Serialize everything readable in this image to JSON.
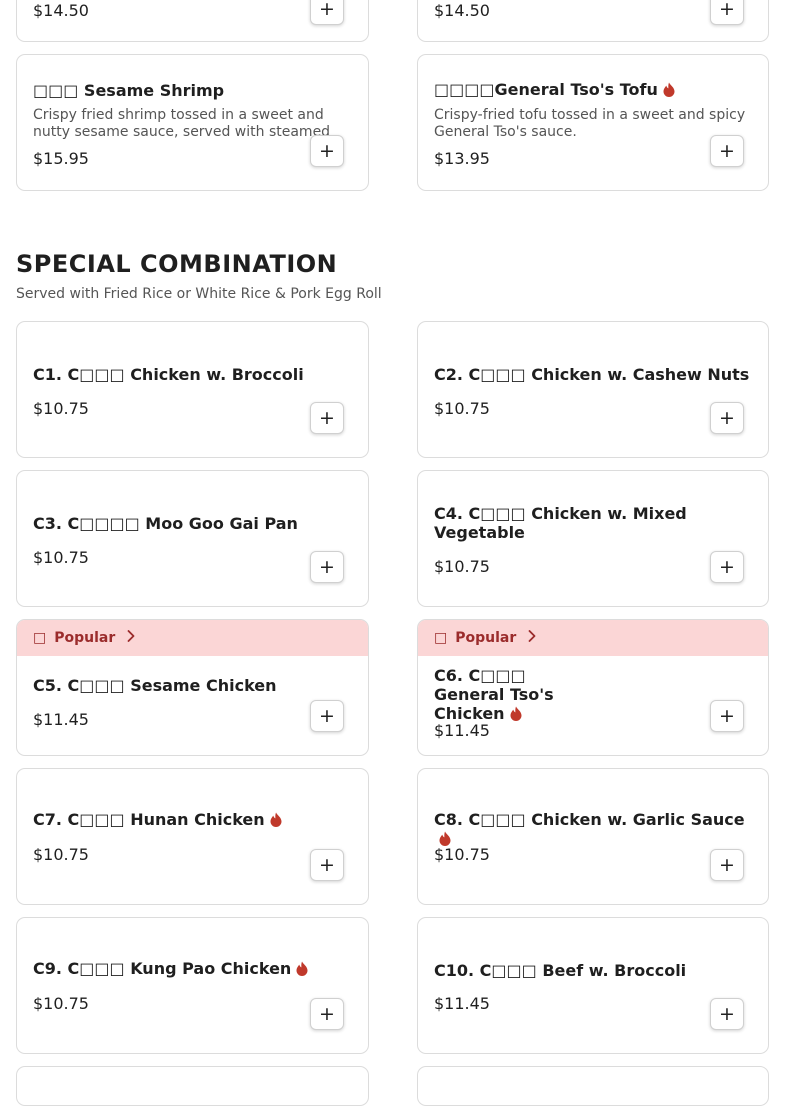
{
  "top_partial": {
    "left": {
      "price": "$14.50"
    },
    "right": {
      "price": "$14.50"
    }
  },
  "items_top": [
    {
      "name": "□□□ Sesame Shrimp",
      "desc": "Crispy fried shrimp tossed in a sweet and nutty sesame sauce, served with steamed broccoli.",
      "price": "$15.95",
      "spicy": false
    },
    {
      "name": "□□□□General Tso's Tofu",
      "desc": "Crispy-fried tofu tossed in a sweet and spicy General Tso's sauce.",
      "price": "$13.95",
      "spicy": true
    }
  ],
  "section": {
    "title": "SPECIAL COMBINATION",
    "subtitle": "Served with Fried Rice or White Rice & Pork Egg Roll"
  },
  "combo_items": [
    {
      "name": "C1. C□□□ Chicken w. Broccoli",
      "price": "$10.75",
      "spicy": false
    },
    {
      "name": "C2. C□□□ Chicken w. Cashew Nuts",
      "price": "$10.75",
      "spicy": false
    },
    {
      "name": "C3. C□□□□ Moo Goo Gai Pan",
      "price": "$10.75",
      "spicy": false
    },
    {
      "name": "C4. C□□□ Chicken w. Mixed Vegetable",
      "price": "$10.75",
      "spicy": false
    },
    {
      "name": "C5. C□□□ Sesame Chicken",
      "price": "$11.45",
      "spicy": false,
      "popular": true
    },
    {
      "name": "C6. C□□□ General Tso's Chicken",
      "price": "$11.45",
      "spicy": true,
      "popular": true
    },
    {
      "name": "C7. C□□□ Hunan Chicken",
      "price": "$10.75",
      "spicy": true
    },
    {
      "name": "C8. C□□□ Chicken w. Garlic Sauce",
      "price": "$10.75",
      "spicy": true
    },
    {
      "name": "C9. C□□□ Kung Pao Chicken",
      "price": "$10.75",
      "spicy": true
    },
    {
      "name": "C10. C□□□ Beef w. Broccoli",
      "price": "$11.45",
      "spicy": false
    }
  ],
  "popular_banner": {
    "icon": "□",
    "label": "Popular",
    "chevron_icon": "chevron-right-icon",
    "bg_color": "#fbd6d6",
    "text_color": "#9b2c2c"
  },
  "add_button": {
    "label": "+"
  },
  "spicy_icon": {
    "name": "fire-icon",
    "color": "#c0392b"
  }
}
